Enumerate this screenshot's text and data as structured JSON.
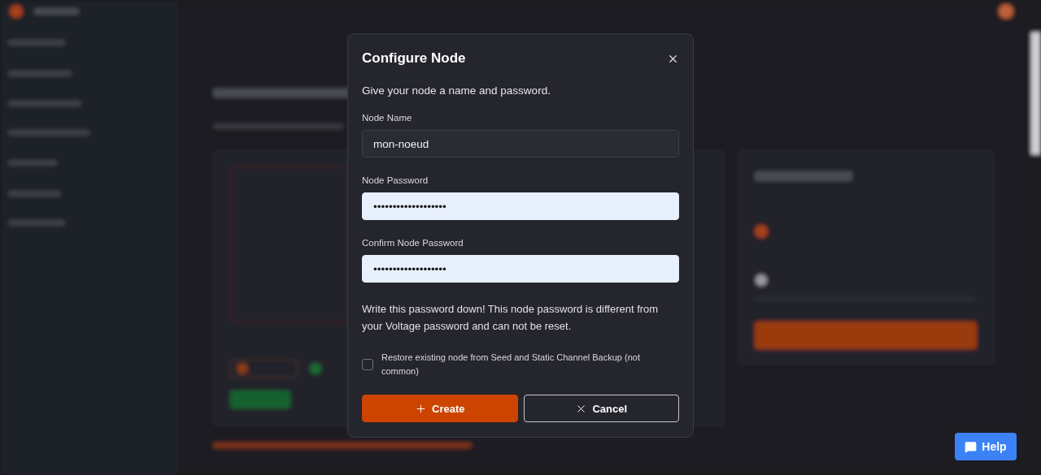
{
  "dialog": {
    "title": "Configure Node",
    "subtitle": "Give your node a name and password.",
    "fields": [
      {
        "label": "Node Name",
        "value": "mon-noeud",
        "autofilled": false
      },
      {
        "label": "Node Password",
        "value": "•••••••••••••••••••",
        "autofilled": true
      },
      {
        "label": "Confirm Node Password",
        "value": "•••••••••••••••••••",
        "autofilled": true
      }
    ],
    "warning": "Write this password down! This node password is different from your Voltage password and can not be reset.",
    "restore": {
      "label": "Restore existing node from Seed and Static Channel Backup (not common)",
      "checked": false
    },
    "buttons": [
      {
        "kind": "primary",
        "label": "Create"
      },
      {
        "kind": "secondary",
        "label": "Cancel"
      }
    ]
  },
  "help": {
    "label": "Help"
  }
}
